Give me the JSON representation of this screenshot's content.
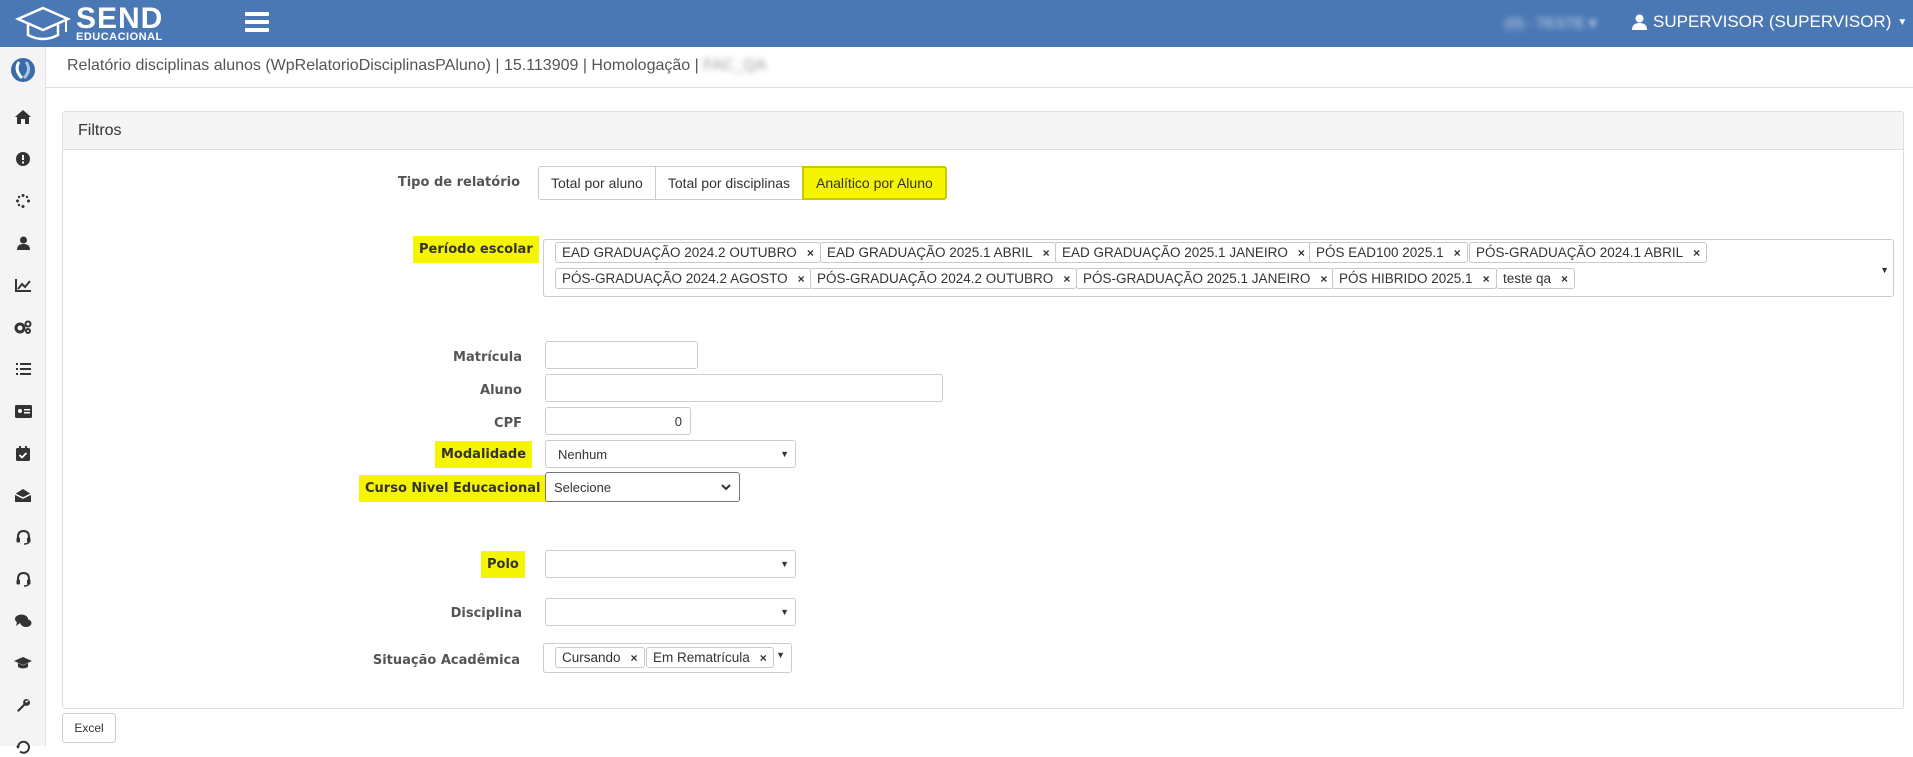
{
  "header": {
    "logo_main": "SEND",
    "logo_sub": "EDUCACIONAL",
    "blurred_env": "(0) - TESTE",
    "user_label": "SUPERVISOR (SUPERVISOR)",
    "bg_color": "#4a78b5"
  },
  "sidebar": {
    "items": [
      {
        "icon": "app-logo-icon"
      },
      {
        "icon": "home-icon"
      },
      {
        "icon": "alert-icon"
      },
      {
        "icon": "spinner-icon"
      },
      {
        "icon": "user-icon"
      },
      {
        "icon": "chart-icon"
      },
      {
        "icon": "cogs-icon"
      },
      {
        "icon": "list-icon"
      },
      {
        "icon": "id-card-icon"
      },
      {
        "icon": "calendar-check-icon"
      },
      {
        "icon": "inbox-icon"
      },
      {
        "icon": "headset-icon"
      },
      {
        "icon": "headset-icon"
      },
      {
        "icon": "comments-icon"
      },
      {
        "icon": "graduation-cap-icon"
      },
      {
        "icon": "wrench-icon"
      },
      {
        "icon": "history-icon"
      }
    ]
  },
  "breadcrumb": {
    "text": "Relatório disciplinas alunos (WpRelatorioDisciplinasPAluno) | 15.113909 | Homologação |",
    "blurred": "FAC_QA"
  },
  "panel": {
    "title": "Filtros"
  },
  "form": {
    "tipo_relatorio": {
      "label": "Tipo de relatório",
      "options": [
        "Total por aluno",
        "Total por disciplinas",
        "Analítico por Aluno"
      ],
      "selected": "Analítico por Aluno"
    },
    "periodo": {
      "label": "Período escolar",
      "chips": [
        "EAD GRADUAÇÃO 2024.2 OUTUBRO",
        "EAD GRADUAÇÃO 2025.1 ABRIL",
        "EAD GRADUAÇÃO 2025.1 JANEIRO",
        "PÓS EAD100 2025.1",
        "PÓS-GRADUAÇÃO 2024.1 ABRIL",
        "PÓS-GRADUAÇÃO 2024.2 AGOSTO",
        "PÓS-GRADUAÇÃO 2024.2 OUTUBRO",
        "PÓS-GRADUAÇÃO 2025.1 JANEIRO",
        "PÓS HIBRIDO 2025.1",
        "teste qa"
      ]
    },
    "matricula": {
      "label": "Matrícula",
      "value": ""
    },
    "aluno": {
      "label": "Aluno",
      "value": ""
    },
    "cpf": {
      "label": "CPF",
      "value": "0"
    },
    "modalidade": {
      "label": "Modalidade",
      "value": "Nenhum"
    },
    "curso_nivel": {
      "label": "Curso Nivel Educacional",
      "value": "Selecione"
    },
    "polo": {
      "label": "Polo",
      "value": ""
    },
    "disciplina": {
      "label": "Disciplina",
      "value": ""
    },
    "situacao": {
      "label": "Situação Acadêmica",
      "chips": [
        "Cursando",
        "Em Rematrícula"
      ]
    }
  },
  "footer": {
    "excel_label": "Excel"
  }
}
